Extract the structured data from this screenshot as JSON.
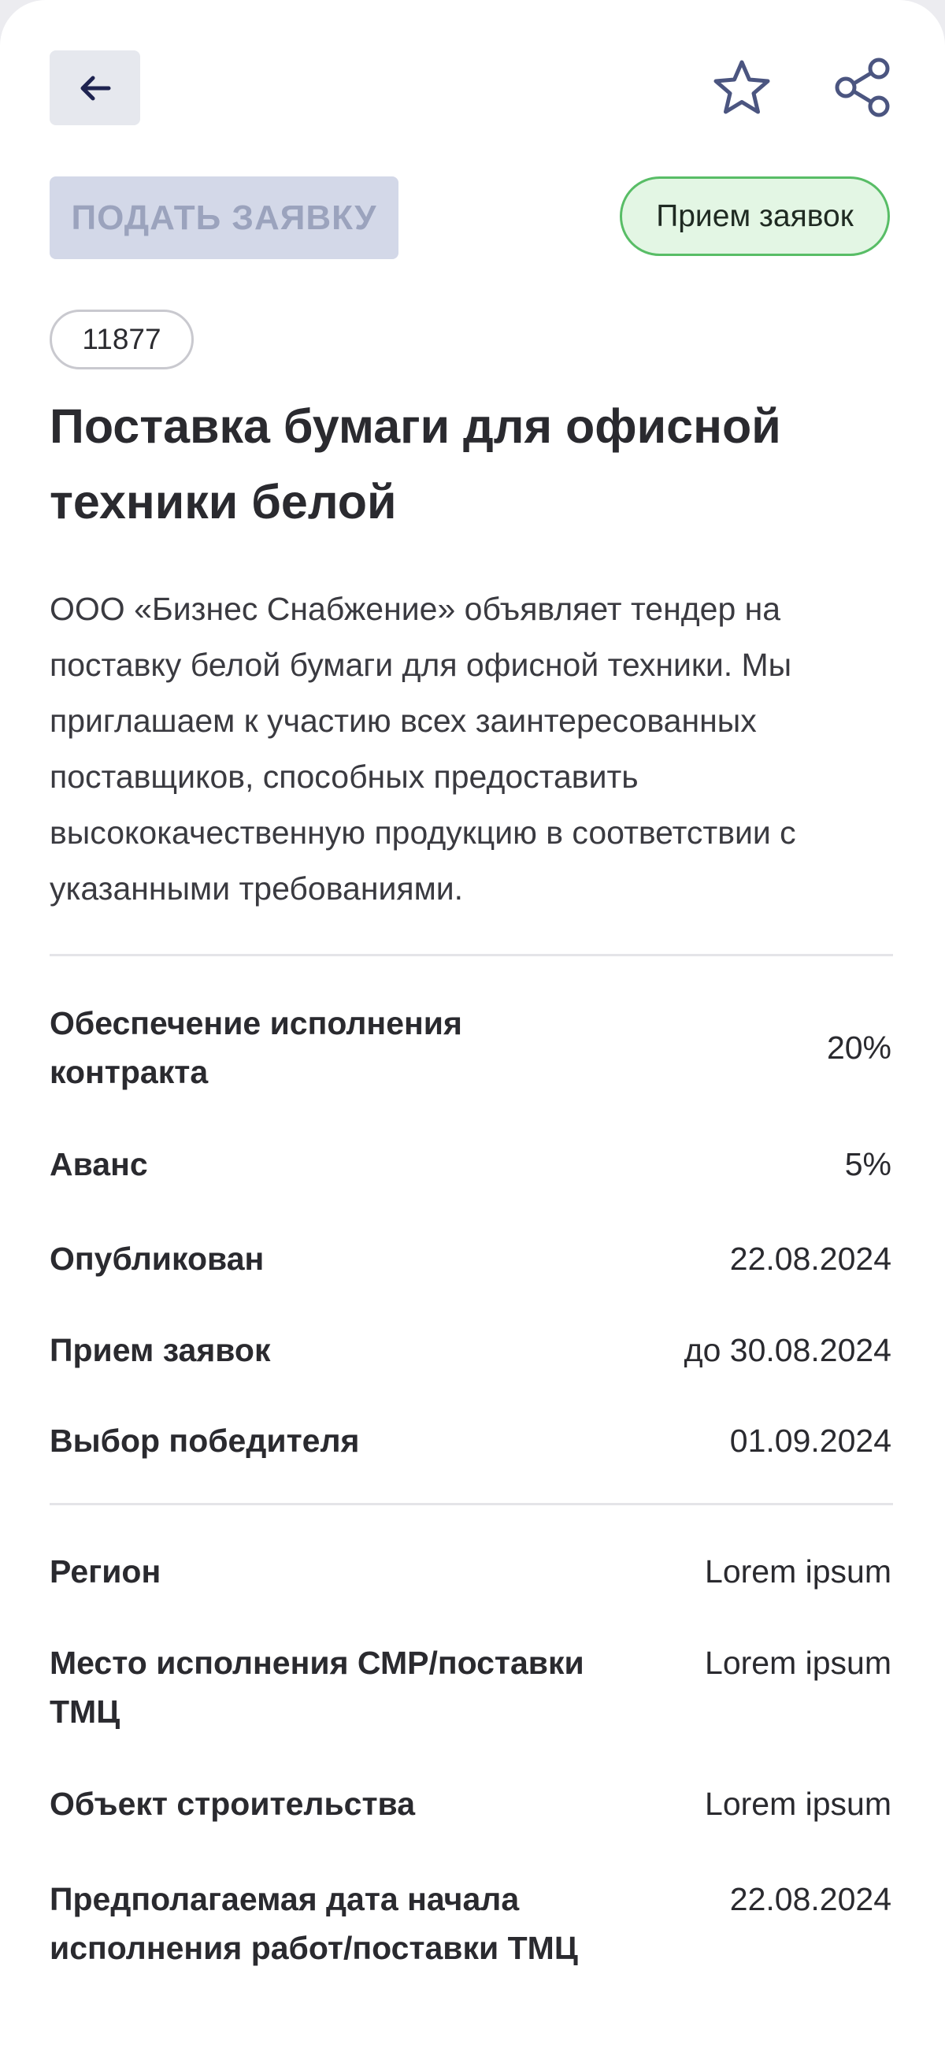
{
  "header": {
    "back_icon": "arrow-left-icon",
    "favorite_icon": "star-icon",
    "share_icon": "share-icon"
  },
  "actions": {
    "apply_label": "ПОДАТЬ ЗАЯВКУ",
    "status_label": "Прием заявок"
  },
  "tender": {
    "id": "11877",
    "title": "Поставка бумаги для офисной техники белой",
    "description": "ООО «Бизнес Снабжение» объявляет тендер на поставку белой бумаги для офисной техники. Мы приглашаем к участию всех заинтересованных поставщиков, способных предоставить высококачественную продукцию в соответствии с указанными требованиями."
  },
  "terms": [
    {
      "label": "Обеспечение исполнения контракта",
      "value": "20%"
    },
    {
      "label": "Аванс",
      "value": "5%"
    },
    {
      "label": "Опубликован",
      "value": "22.08.2024"
    },
    {
      "label": "Прием заявок",
      "value": "до 30.08.2024"
    },
    {
      "label": "Выбор победителя",
      "value": "01.09.2024"
    }
  ],
  "details": [
    {
      "label": "Регион",
      "value": "Lorem ipsum"
    },
    {
      "label": "Место исполнения СМР/поставки ТМЦ",
      "value": "Lorem ipsum"
    },
    {
      "label": "Объект строительства",
      "value": "Lorem ipsum"
    },
    {
      "label": "Предполагаемая дата начала исполнения работ/поставки ТМЦ",
      "value": "22.08.2024"
    }
  ],
  "colors": {
    "status_border": "#58bd66",
    "status_bg": "#e3f6e4",
    "apply_disabled_bg": "#d3d8e8",
    "icon_color": "#4b5580"
  }
}
